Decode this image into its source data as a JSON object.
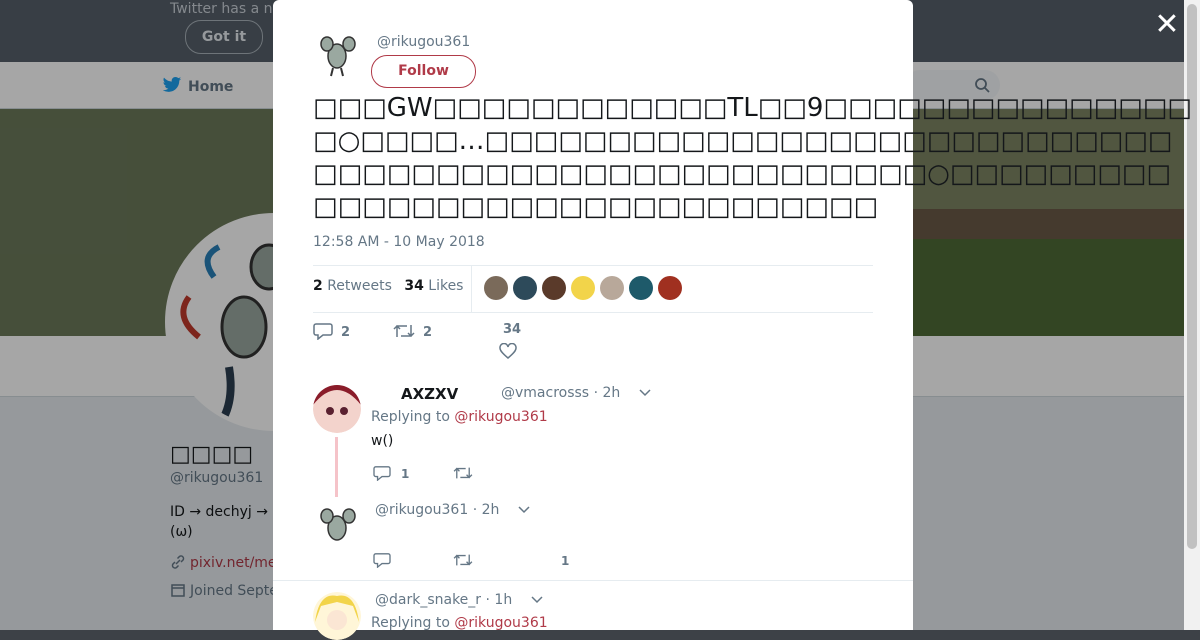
{
  "background_page": {
    "notice_text": "Twitter has a n",
    "got_it_label": "Got it",
    "nav_home_label": "Home",
    "profile_name": "□□□□",
    "profile_handle": "@rikugou361",
    "profile_bio": "ID → dechyj → (ω)",
    "profile_link": "pixiv.net/me",
    "profile_joined": "Joined Septe"
  },
  "modal": {
    "close_label": "✕",
    "author_handle": "@rikugou361",
    "follow_label": "Follow",
    "tweet_text": "□□□GW□□□□□□□□□□□□TL□□9□□□□□□□□□□□□□□□□○□□□□…□□□□□□□□□□□□□□□□□□□□□□□□□□□□□□□□□□□□□□□□□□□□□□□□□□□□□○□□□□□□□□□□□□□□□□□□□□□□□□□□□□□□□□",
    "timestamp": "12:58 AM - 10 May 2018",
    "retweets_count": "2",
    "retweets_label": "Retweets",
    "likes_count": "34",
    "likes_label": "Likes",
    "liker_colors": [
      "#7a6a5a",
      "#2d4a5a",
      "#5a3a2a",
      "#f2d44a",
      "#b8a89a",
      "#1e5a6a",
      "#a03020"
    ],
    "actions": {
      "reply_count": "2",
      "retweet_count": "2",
      "like_count": "34"
    }
  },
  "replies": [
    {
      "name": "AXZXV",
      "handle": "@vmacrosss",
      "time": "· 2h",
      "replying_to_prefix": "Replying to",
      "replying_to": "@rikugou361",
      "text": "w()",
      "reply_count": "1"
    },
    {
      "handle": "@rikugou361",
      "time": "· 2h",
      "like_count": "1"
    },
    {
      "handle": "@dark_snake_r",
      "time": "· 1h",
      "replying_to_prefix": "Replying to",
      "replying_to": "@rikugou361"
    }
  ],
  "colors": {
    "accent": "#b03a48",
    "muted": "#657786",
    "text": "#14171a"
  }
}
